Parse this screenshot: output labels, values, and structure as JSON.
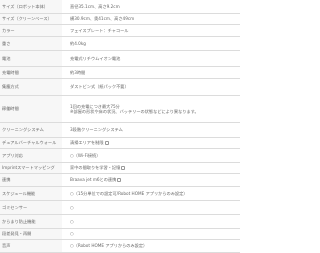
{
  "rows": [
    {
      "label": "サイズ（ロボット本体）",
      "value": "直径35.1cm、高さ9.2cm",
      "h": 13
    },
    {
      "label": "サイズ（クリーンベース）",
      "value": "横30.9cm、奥41cm、高さ49cm",
      "h": 11
    },
    {
      "label": "カラー",
      "value": "フェイスプレート：チャコール",
      "h": 12
    },
    {
      "label": "重さ",
      "value": "約4.0kg",
      "h": 14
    },
    {
      "label": "電池",
      "value": "充電式リチウムイオン電池",
      "h": 16
    },
    {
      "label": "充電時間",
      "value": "約3時間",
      "h": 12
    },
    {
      "label": "集塵方式",
      "value": "ダストビン式（紙パック不要）",
      "h": 17
    },
    {
      "label": "稼働時間",
      "value": "1回の充電につき最大75分",
      "value2": "※部屋の形状や床の状況、バッテリーの状態などにより異なります。",
      "h": 27
    },
    {
      "label": "クリーニングシステム",
      "value": "3段階クリーニングシステム",
      "h": 15
    },
    {
      "label": "デュアルバーチャルウォール",
      "value": "清掃エリアを制限",
      "check": true,
      "h": 11
    },
    {
      "label": "アプリ対応",
      "value": "○（Wi-Fi接続）",
      "h": 14
    },
    {
      "label": "Imprintスマートマッピング",
      "value": "家中の間取りを学習・記憶",
      "check": true,
      "h": 11
    },
    {
      "label": "連携",
      "value": "Braava jet m6との連携",
      "check": true,
      "h": 13
    },
    {
      "label": "スケジュール機能",
      "value": "○（15分単位での設定可/Robot HOME アプリからのみ設定）",
      "h": 14
    },
    {
      "label": "ゴミセンサー",
      "value": "○",
      "h": 14
    },
    {
      "label": "からまり防止機能",
      "value": "○",
      "h": 14
    },
    {
      "label": "段差発見・再開",
      "value": "○",
      "h": 11
    },
    {
      "label": "音声",
      "value": "○（Robot HOME アプリからのみ設定）",
      "h": 13
    }
  ]
}
